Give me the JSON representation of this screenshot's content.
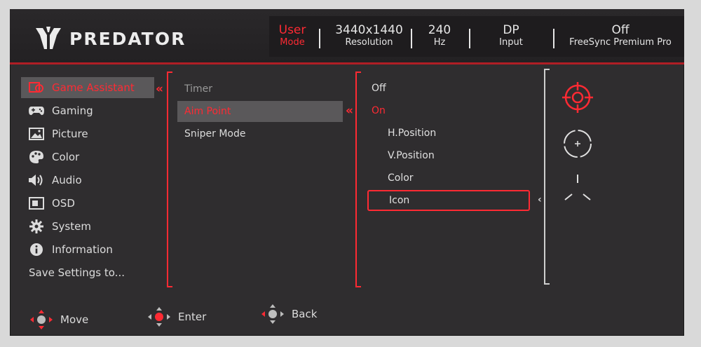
{
  "brand": {
    "logo_text": "PREDATOR"
  },
  "header": [
    {
      "value": "User",
      "label": "Mode",
      "active": true
    },
    {
      "value": "3440x1440",
      "label": "Resolution"
    },
    {
      "value": "240",
      "label": "Hz"
    },
    {
      "value": "DP",
      "label": "Input"
    },
    {
      "value": "Off",
      "label": "FreeSync Premium Pro"
    }
  ],
  "sidebar": {
    "items": [
      {
        "label": "Game Assistant",
        "icon": "game-assistant-icon",
        "selected": true
      },
      {
        "label": "Gaming",
        "icon": "gamepad-icon"
      },
      {
        "label": "Picture",
        "icon": "picture-icon"
      },
      {
        "label": "Color",
        "icon": "palette-icon"
      },
      {
        "label": "Audio",
        "icon": "speaker-icon"
      },
      {
        "label": "OSD",
        "icon": "osd-icon"
      },
      {
        "label": "System",
        "icon": "gear-icon"
      },
      {
        "label": "Information",
        "icon": "info-icon"
      },
      {
        "label": "Save Settings to..."
      }
    ]
  },
  "submenu": {
    "items": [
      {
        "label": "Timer",
        "state": "dim"
      },
      {
        "label": "Aim Point",
        "state": "selected"
      },
      {
        "label": "Sniper Mode"
      }
    ]
  },
  "options": {
    "items": [
      {
        "label": "Off"
      },
      {
        "label": "On",
        "state": "selected"
      },
      {
        "label": "H.Position"
      },
      {
        "label": "V.Position"
      },
      {
        "label": "Color"
      },
      {
        "label": "Icon",
        "state": "focused"
      }
    ]
  },
  "icon_choices": [
    {
      "icon": "crosshair-circle-icon",
      "selected": true
    },
    {
      "icon": "crosshair-dashed-circle-icon"
    },
    {
      "icon": "crosshair-y-icon"
    }
  ],
  "footer": {
    "move_label": "Move",
    "enter_label": "Enter",
    "back_label": "Back"
  },
  "colors": {
    "accent": "#ff2a33",
    "panel": "#2f2d2f",
    "selection": "#5a585a"
  }
}
